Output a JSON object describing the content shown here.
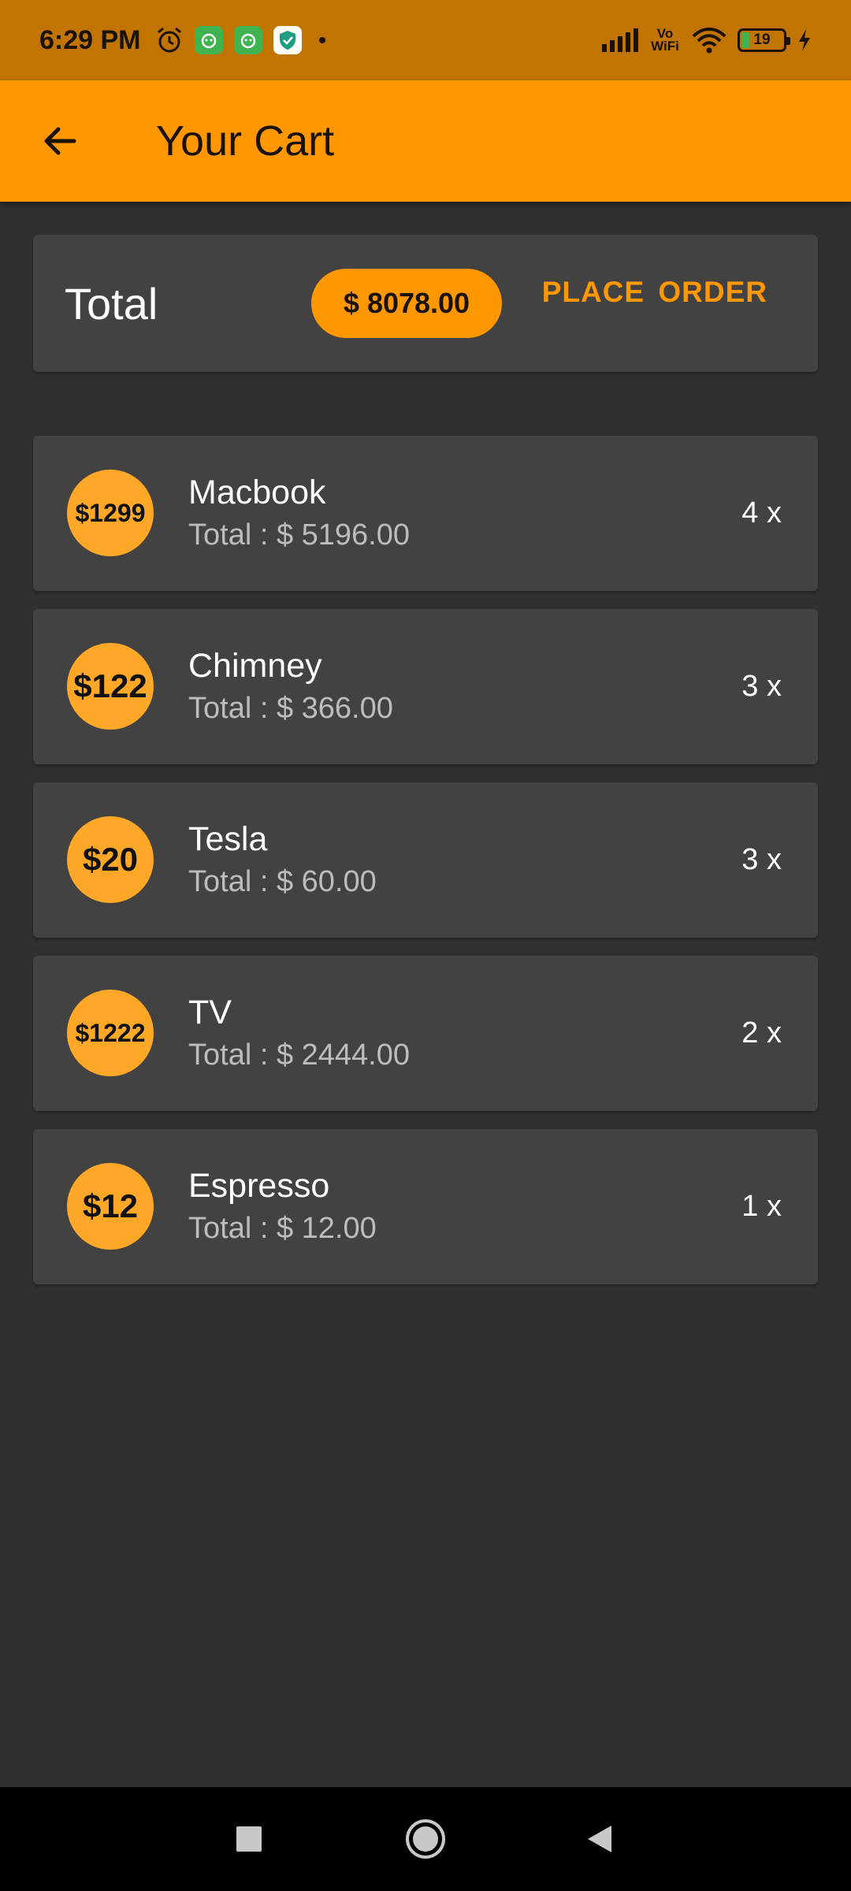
{
  "status_bar": {
    "time": "6:29 PM",
    "network": "Vo WiFi",
    "battery": "19",
    "icons": [
      "alarm-icon",
      "app-notification-icon",
      "app-notification-icon",
      "shield-icon",
      "signal-icon",
      "wifi-icon",
      "battery-icon",
      "charging-icon"
    ]
  },
  "app_bar": {
    "title": "Your Cart",
    "back_icon": "arrow-left-icon"
  },
  "summary": {
    "label": "Total",
    "amount": "$ 8078.00",
    "action": "PLACE  ORDER"
  },
  "cart": {
    "items": [
      {
        "price": "$1299",
        "name": "Macbook",
        "total": "Total : $ 5196.00",
        "qty": "4 x"
      },
      {
        "price": "$122",
        "name": "Chimney",
        "total": "Total : $ 366.00",
        "qty": "3 x"
      },
      {
        "price": "$20",
        "name": "Tesla",
        "total": "Total : $ 60.00",
        "qty": "3 x"
      },
      {
        "price": "$1222",
        "name": "TV",
        "total": "Total : $ 2444.00",
        "qty": "2 x"
      },
      {
        "price": "$12",
        "name": "Espresso",
        "total": "Total : $ 12.00",
        "qty": "1 x"
      }
    ]
  },
  "nav_bar": {
    "icons": [
      "recents-square-icon",
      "home-circle-icon",
      "back-triangle-icon"
    ]
  },
  "colors": {
    "accent": "#FF9800",
    "status_bar": "#C27400",
    "background": "#303030",
    "card": "#424242",
    "badge": "#FFA726"
  }
}
